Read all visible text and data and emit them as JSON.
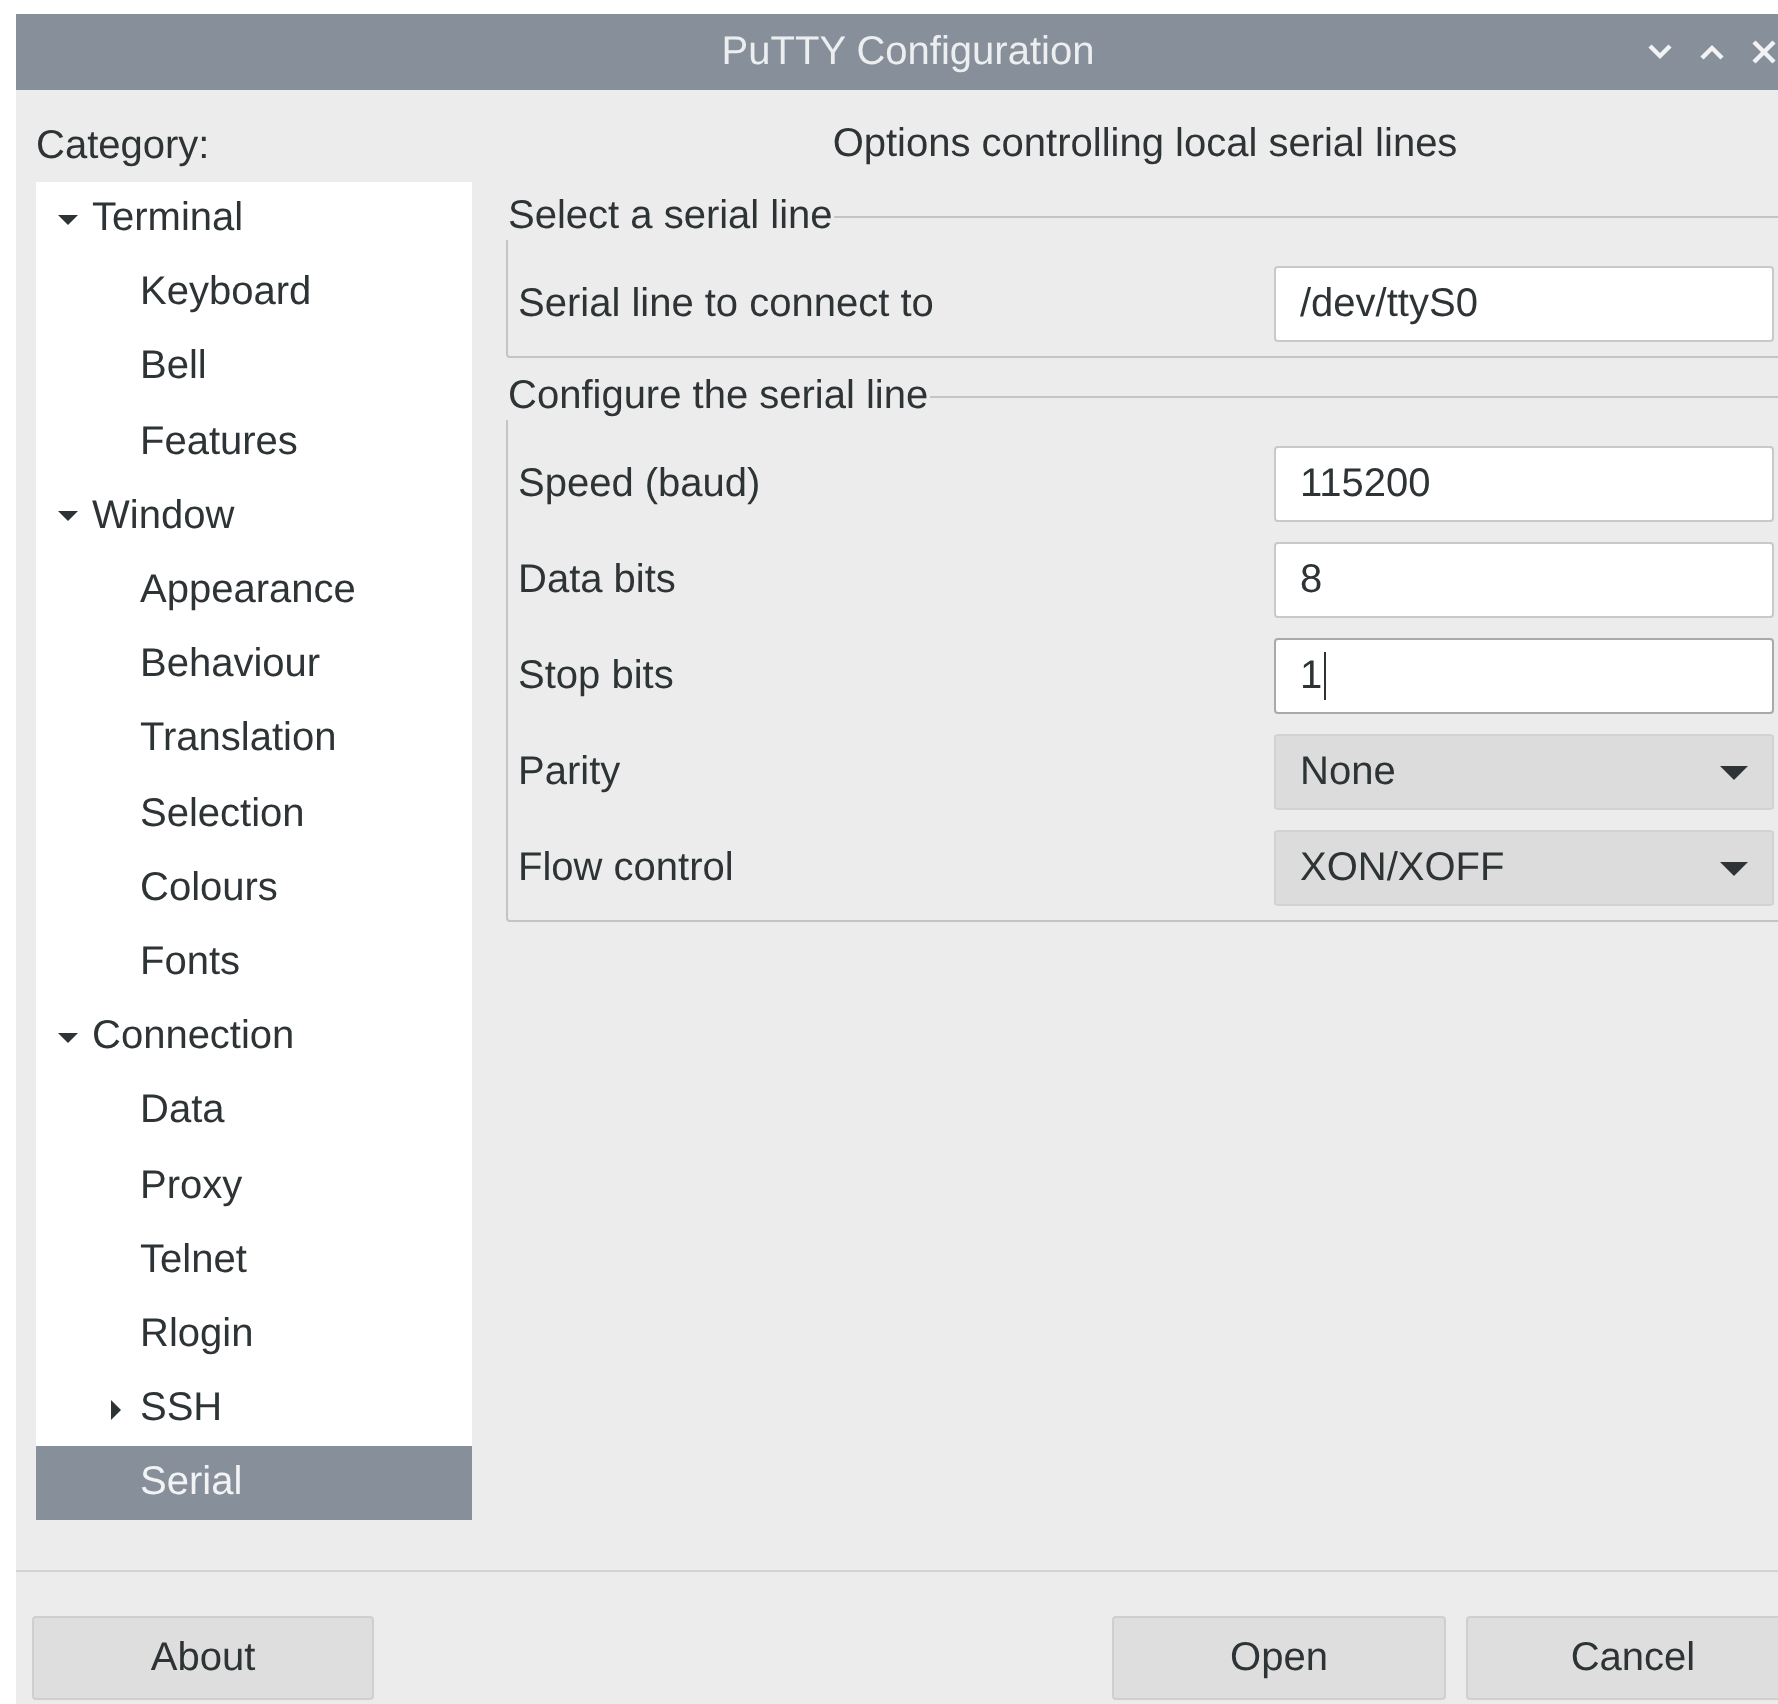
{
  "window": {
    "title": "PuTTY Configuration"
  },
  "category": {
    "label": "Category:"
  },
  "tree": [
    {
      "label": "Terminal",
      "expanded": true,
      "selected": false,
      "children": [
        {
          "label": "Keyboard",
          "selected": false
        },
        {
          "label": "Bell",
          "selected": false
        },
        {
          "label": "Features",
          "selected": false
        }
      ]
    },
    {
      "label": "Window",
      "expanded": true,
      "selected": false,
      "children": [
        {
          "label": "Appearance",
          "selected": false
        },
        {
          "label": "Behaviour",
          "selected": false
        },
        {
          "label": "Translation",
          "selected": false
        },
        {
          "label": "Selection",
          "selected": false
        },
        {
          "label": "Colours",
          "selected": false
        },
        {
          "label": "Fonts",
          "selected": false
        }
      ]
    },
    {
      "label": "Connection",
      "expanded": true,
      "selected": false,
      "children": [
        {
          "label": "Data",
          "selected": false
        },
        {
          "label": "Proxy",
          "selected": false
        },
        {
          "label": "Telnet",
          "selected": false
        },
        {
          "label": "Rlogin",
          "selected": false
        },
        {
          "label": "SSH",
          "expanded": false,
          "selected": false
        },
        {
          "label": "Serial",
          "selected": true
        }
      ]
    }
  ],
  "panel": {
    "heading": "Options controlling local serial lines",
    "groups": [
      {
        "title": "Select a serial line",
        "rows": [
          {
            "kind": "text",
            "label": "Serial line to connect to",
            "value": "/dev/ttyS0",
            "focused": false
          }
        ]
      },
      {
        "title": "Configure the serial line",
        "rows": [
          {
            "kind": "text",
            "label": "Speed (baud)",
            "value": "115200",
            "focused": false
          },
          {
            "kind": "text",
            "label": "Data bits",
            "value": "8",
            "focused": false
          },
          {
            "kind": "text",
            "label": "Stop bits",
            "value": "1",
            "focused": true
          },
          {
            "kind": "dropdown",
            "label": "Parity",
            "value": "None"
          },
          {
            "kind": "dropdown",
            "label": "Flow control",
            "value": "XON/XOFF"
          }
        ]
      }
    ]
  },
  "buttons_left": [
    {
      "label": "About"
    }
  ],
  "buttons_right": [
    {
      "label": "Open"
    },
    {
      "label": "Cancel"
    }
  ]
}
